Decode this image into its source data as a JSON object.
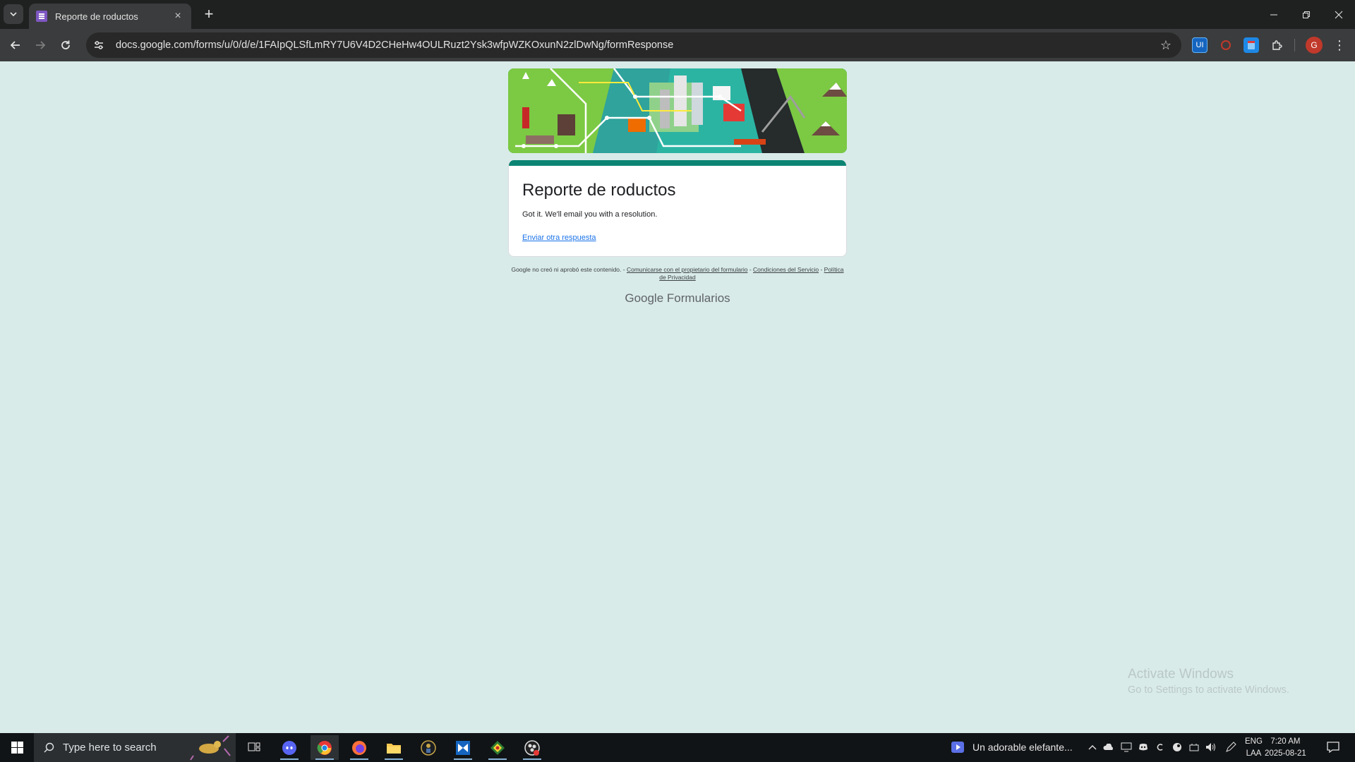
{
  "browser": {
    "tab": {
      "title": "Reporte de roductos",
      "close_label": "×"
    },
    "new_tab_label": "+",
    "url": "docs.google.com/forms/u/0/d/e/1FAIpQLSfLmRY7U6V4D2CHeHw4OULRuzt2Ysk3wfpWZKOxunN2zlDwNg/formResponse",
    "avatar_letter": "G"
  },
  "form": {
    "title": "Reporte de roductos",
    "confirmation": "Got it. We'll email you with a resolution.",
    "another_response": "Enviar otra respuesta",
    "accent_color": "#0b8473",
    "disclaimer_prefix": "Google no creó ni aprobó este contenido. - ",
    "contact_link": "Comunicarse con el propietario del formulario",
    "sep": " - ",
    "terms_link": "Condiciones del Servicio",
    "privacy_link": "Política de Privacidad",
    "brand_google": "Google",
    "brand_product": "Formularios"
  },
  "watermark": {
    "line1": "Activate Windows",
    "line2": "Go to Settings to activate Windows."
  },
  "taskbar": {
    "search_placeholder": "Type here to search",
    "media_title": "Un adorable elefante...",
    "lang_line1": "ENG",
    "lang_line2": "LAA",
    "time": "7:20 AM",
    "date": "2025-08-21"
  }
}
